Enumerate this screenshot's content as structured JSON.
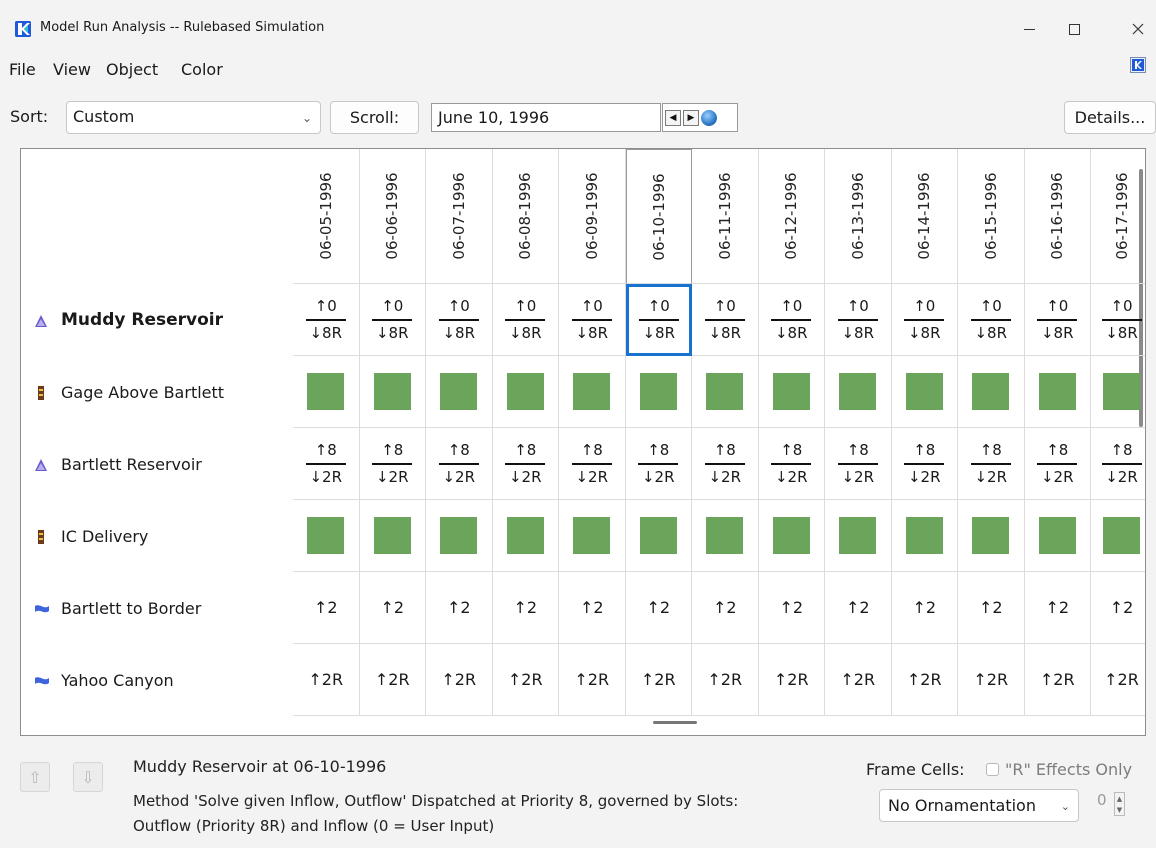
{
  "window": {
    "title": "Model Run Analysis -- Rulebased Simulation",
    "icons": {
      "app": "app-logo-icon",
      "minimize": "minimize-icon",
      "maximize": "maximize-icon",
      "close": "close-icon"
    }
  },
  "menu": {
    "items": [
      "File",
      "View",
      "Object",
      "Color"
    ],
    "right_icon": "window-pin-icon"
  },
  "toolbar": {
    "sort_label": "Sort:",
    "sort_value": "Custom",
    "scroll_button": "Scroll:",
    "date_value": "June 10, 1996",
    "details_button": "Details..."
  },
  "grid": {
    "selected_column": "06-10-1996",
    "selected_row": "Muddy Reservoir",
    "columns": [
      "06-05-1996",
      "06-06-1996",
      "06-07-1996",
      "06-08-1996",
      "06-09-1996",
      "06-10-1996",
      "06-11-1996",
      "06-12-1996",
      "06-13-1996",
      "06-14-1996",
      "06-15-1996",
      "06-16-1996",
      "06-17-1996"
    ],
    "rows": [
      {
        "label": "Muddy Reservoir",
        "icon": "reservoir-icon",
        "bold": true,
        "kind": "fraction",
        "top": "↑0",
        "bottom": "↓8R",
        "last_top": "↑0",
        "last_bottom": "↓8R"
      },
      {
        "label": "Gage Above Bartlett",
        "icon": "gage-icon",
        "bold": false,
        "kind": "block"
      },
      {
        "label": "Bartlett Reservoir",
        "icon": "reservoir-icon",
        "bold": false,
        "kind": "fraction",
        "top": "↑8",
        "bottom": "↓2R",
        "last_top": "↑8",
        "last_bottom": "↓2R"
      },
      {
        "label": "IC Delivery",
        "icon": "gage-icon",
        "bold": false,
        "kind": "block"
      },
      {
        "label": "Bartlett to Border",
        "icon": "reach-icon",
        "bold": false,
        "kind": "single",
        "value": "↑2",
        "last_value": "↑2"
      },
      {
        "label": "Yahoo Canyon",
        "icon": "reach-icon",
        "bold": false,
        "kind": "single",
        "value": "↑2R",
        "last_value": "↑2R"
      }
    ],
    "colors": {
      "block": "#6ba55c",
      "selection": "#1772d0",
      "reservoir": "#6a5acd",
      "reach": "#3e63dd"
    }
  },
  "details": {
    "heading": "Muddy Reservoir at 06-10-1996",
    "line1": "Method 'Solve given Inflow, Outflow' Dispatched at Priority 8, governed by Slots:",
    "line2": "Outflow (Priority 8R) and Inflow (0 = User Input)",
    "frame_cells_label": "Frame Cells:",
    "r_effects_label": "\"R\" Effects Only",
    "ornamentation": "No Ornamentation",
    "spin_value": "0",
    "up_icon": "arrow-up-icon",
    "down_icon": "arrow-down-icon"
  }
}
